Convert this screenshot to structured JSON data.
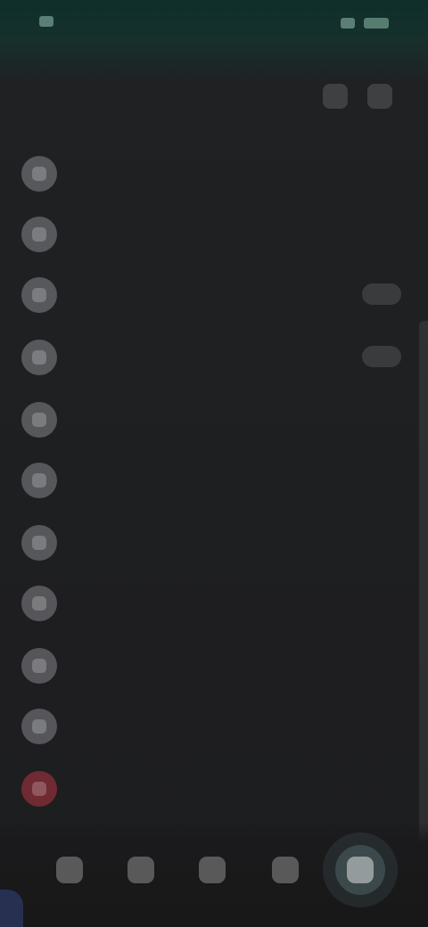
{
  "statusbar": {
    "time": "",
    "battery": ""
  },
  "header": {
    "title": ""
  },
  "menu": {
    "items": [
      {
        "label": "",
        "icon": "person-icon",
        "trailing": ""
      },
      {
        "label": "",
        "icon": "star-icon",
        "trailing": ""
      },
      {
        "label": "",
        "icon": "settings-icon",
        "trailing": ""
      },
      {
        "label": "",
        "icon": "shield-icon",
        "trailing": ""
      },
      {
        "label": "",
        "icon": "help-icon",
        "trailing": ""
      },
      {
        "label": "",
        "icon": "info-icon",
        "trailing": ""
      },
      {
        "label": "",
        "icon": "bell-icon",
        "trailing": ""
      },
      {
        "label": "",
        "icon": "privacy-icon",
        "trailing": ""
      },
      {
        "label": "",
        "icon": "storage-icon",
        "trailing": ""
      },
      {
        "label": "",
        "icon": "feedback-icon",
        "trailing": ""
      },
      {
        "label": "",
        "icon": "logout-icon",
        "trailing": ""
      }
    ]
  },
  "bottom_nav": [
    {
      "label": "",
      "icon": "home-icon"
    },
    {
      "label": "",
      "icon": "search-icon"
    },
    {
      "label": "",
      "icon": "library-icon"
    },
    {
      "label": "",
      "icon": "profile-icon"
    },
    {
      "label": "",
      "icon": "settings-icon"
    }
  ],
  "colors": {
    "background": "#1c1c1e",
    "accent": "#7ea2aa",
    "danger": "#d63a4a"
  }
}
